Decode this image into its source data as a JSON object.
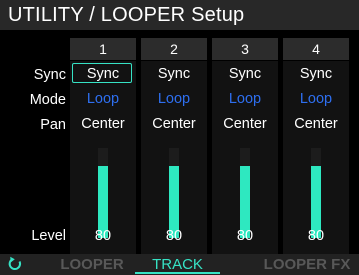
{
  "header": {
    "title": "UTILITY / LOOPER Setup"
  },
  "rows": {
    "sync": "Sync",
    "mode": "Mode",
    "pan": "Pan",
    "level": "Level"
  },
  "tracks": [
    {
      "number": "1",
      "sync": "Sync",
      "mode": "Loop",
      "pan": "Center",
      "level": "80",
      "level_fraction": 0.8,
      "selected": true
    },
    {
      "number": "2",
      "sync": "Sync",
      "mode": "Loop",
      "pan": "Center",
      "level": "80",
      "level_fraction": 0.8,
      "selected": false
    },
    {
      "number": "3",
      "sync": "Sync",
      "mode": "Loop",
      "pan": "Center",
      "level": "80",
      "level_fraction": 0.8,
      "selected": false
    },
    {
      "number": "4",
      "sync": "Sync",
      "mode": "Loop",
      "pan": "Center",
      "level": "80",
      "level_fraction": 0.8,
      "selected": false
    }
  ],
  "footer": {
    "icon": "loop-arrow-icon",
    "tabs": [
      "LOOPER",
      "TRACK",
      "LOOPER FX"
    ],
    "active_tab": "TRACK"
  },
  "colors": {
    "accent": "#36e3c5",
    "mode_text": "#2e6ff0",
    "meter": "#2ee8c0"
  }
}
